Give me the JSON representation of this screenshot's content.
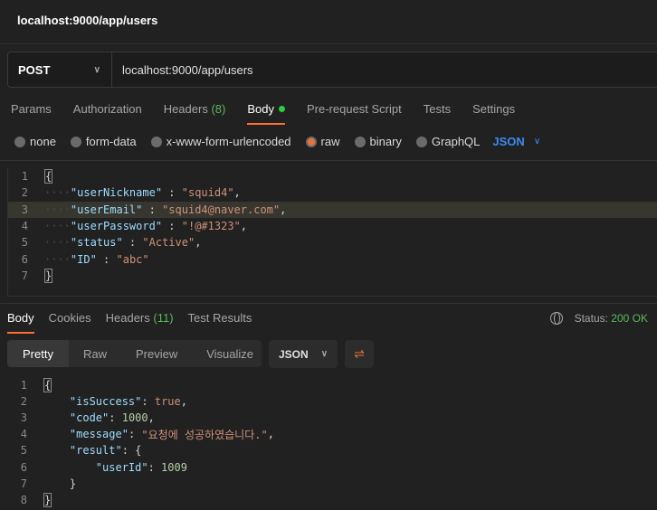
{
  "title": "localhost:9000/app/users",
  "request": {
    "method": "POST",
    "url": "localhost:9000/app/users",
    "tabs": [
      {
        "label": "Params"
      },
      {
        "label": "Authorization"
      },
      {
        "label": "Headers",
        "count": "(8)"
      },
      {
        "label": "Body",
        "active": true,
        "dot": true
      },
      {
        "label": "Pre-request Script"
      },
      {
        "label": "Tests"
      },
      {
        "label": "Settings"
      }
    ],
    "body_types": [
      {
        "label": "none"
      },
      {
        "label": "form-data"
      },
      {
        "label": "x-www-form-urlencoded"
      },
      {
        "label": "raw",
        "selected": true
      },
      {
        "label": "binary"
      },
      {
        "label": "GraphQL"
      }
    ],
    "format": "JSON",
    "body_lines": [
      [
        {
          "t": "{",
          "c": "brace"
        }
      ],
      [
        {
          "t": "····",
          "c": "ws"
        },
        {
          "t": "\"userNickname\"",
          "c": "k"
        },
        {
          "t": " : ",
          "c": "p"
        },
        {
          "t": "\"squid4\"",
          "c": "s"
        },
        {
          "t": ",",
          "c": "p"
        }
      ],
      [
        {
          "t": "····",
          "c": "ws"
        },
        {
          "t": "\"userEmail\"",
          "c": "k"
        },
        {
          "t": " : ",
          "c": "p"
        },
        {
          "t": "\"squid4@naver.com\"",
          "c": "s"
        },
        {
          "t": ",",
          "c": "p"
        }
      ],
      [
        {
          "t": "····",
          "c": "ws"
        },
        {
          "t": "\"userPassword\"",
          "c": "k"
        },
        {
          "t": " : ",
          "c": "p"
        },
        {
          "t": "\"!@#1323\"",
          "c": "s"
        },
        {
          "t": ",",
          "c": "p"
        }
      ],
      [
        {
          "t": "····",
          "c": "ws"
        },
        {
          "t": "\"status\"",
          "c": "k"
        },
        {
          "t": " : ",
          "c": "p"
        },
        {
          "t": "\"Active\"",
          "c": "s"
        },
        {
          "t": ",",
          "c": "p"
        }
      ],
      [
        {
          "t": "····",
          "c": "ws"
        },
        {
          "t": "\"ID\"",
          "c": "k"
        },
        {
          "t": " : ",
          "c": "p"
        },
        {
          "t": "\"abc\"",
          "c": "s"
        }
      ],
      [
        {
          "t": "}",
          "c": "brace"
        }
      ]
    ]
  },
  "response": {
    "tabs": [
      {
        "label": "Body",
        "active": true
      },
      {
        "label": "Cookies"
      },
      {
        "label": "Headers",
        "count": "(11)"
      },
      {
        "label": "Test Results"
      }
    ],
    "status_label": "Status:",
    "status_value": "200 OK",
    "views": [
      "Pretty",
      "Raw",
      "Preview",
      "Visualize"
    ],
    "format": "JSON",
    "body_lines": [
      [
        {
          "t": "{",
          "c": "brace"
        }
      ],
      [
        {
          "t": "    ",
          "c": "p"
        },
        {
          "t": "\"isSuccess\"",
          "c": "k"
        },
        {
          "t": ": ",
          "c": "p"
        },
        {
          "t": "true",
          "c": "b"
        },
        {
          "t": ",",
          "c": "p"
        }
      ],
      [
        {
          "t": "    ",
          "c": "p"
        },
        {
          "t": "\"code\"",
          "c": "k"
        },
        {
          "t": ": ",
          "c": "p"
        },
        {
          "t": "1000",
          "c": "n"
        },
        {
          "t": ",",
          "c": "p"
        }
      ],
      [
        {
          "t": "    ",
          "c": "p"
        },
        {
          "t": "\"message\"",
          "c": "k"
        },
        {
          "t": ": ",
          "c": "p"
        },
        {
          "t": "\"요청에 성공하였습니다.\"",
          "c": "s"
        },
        {
          "t": ",",
          "c": "p"
        }
      ],
      [
        {
          "t": "    ",
          "c": "p"
        },
        {
          "t": "\"result\"",
          "c": "k"
        },
        {
          "t": ": {",
          "c": "p"
        }
      ],
      [
        {
          "t": "        ",
          "c": "p"
        },
        {
          "t": "\"userId\"",
          "c": "k"
        },
        {
          "t": ": ",
          "c": "p"
        },
        {
          "t": "1009",
          "c": "n"
        }
      ],
      [
        {
          "t": "    }",
          "c": "p"
        }
      ],
      [
        {
          "t": "}",
          "c": "brace"
        }
      ]
    ]
  }
}
